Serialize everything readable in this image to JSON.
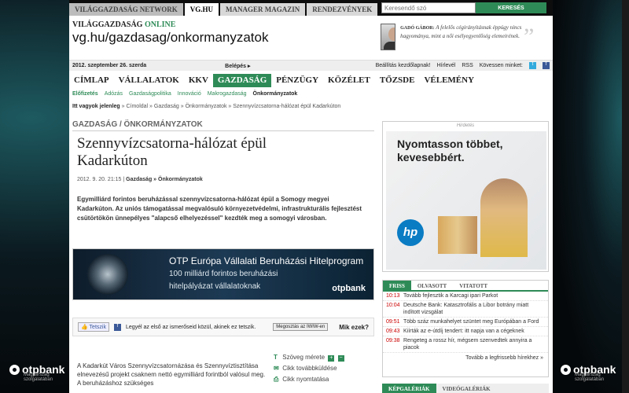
{
  "topnav": {
    "tabs": [
      {
        "label": "VILÁGGAZDASÁG Network",
        "active": false
      },
      {
        "label": "VG.hu",
        "active": true
      },
      {
        "label": "manager magazin",
        "active": false
      },
      {
        "label": "RENDEZVÉNYEK",
        "active": false
      }
    ],
    "search_placeholder": "Keresendő szó",
    "search_button": "KERESÉS"
  },
  "header": {
    "brand_prefix": "VILÁGGAZDASÁG",
    "brand_suffix": "ONLINE",
    "url": "vg.hu/gazdasag/onkormanyzatok",
    "quote_author": "GADÓ GÁBOR:",
    "quote_text": "A felelős cégirányításnak éppúgy nincs hagyománya, mint a női esélyegyenlőség elemeirének."
  },
  "datebar": {
    "date": "2012. szeptember 26. szerda",
    "login": "Belépés",
    "homepage": "Beállítás kezdőlapnak!",
    "newsletter": "Hírlevél",
    "rss": "RSS",
    "follow": "Kövessen minket:"
  },
  "mainnav": [
    "CÍMLAP",
    "VÁLLALATOK",
    "KKV",
    "GAZDASÁG",
    "PÉNZÜGY",
    "KÖZÉLET",
    "TŐZSDE",
    "VÉLEMÉNY"
  ],
  "mainnav_active": "GAZDASÁG",
  "subnav": [
    "Előfizetés",
    "Adózás",
    "Gazdaságpolitika",
    "Innováció",
    "Makrogazdaság",
    "Önkormányzatok"
  ],
  "breadcrumb": {
    "prefix": "Itt vagyok jelenleg",
    "path": "»  Címoldal  »  Gazdaság  »  Önkormányzatok  »  Szennyvízcsatorna-hálózat épül Kadarkúton"
  },
  "section_title": "GAZDASÁG / ÖNKORMÁNYZATOK",
  "article": {
    "title": "Szennyvízcsatorna-hálózat épül Kadarkúton",
    "date": "2012. 9. 20. 21:15 |",
    "category": "Gazdaság » Önkormányzatok",
    "lead": "Egymilliárd forintos beruházással szennyvízcsatorna-hálózat épül a Somogy megyei Kadarkúton. Az uniós támogatással megvalósuló környezetvédelmi, infrastrukturális fejlesztést csütörtökön ünnepélyes \"alapcső elhelyezéssel\" kezdték meg a somogyi városban.",
    "body": "A Kadarkút Város Szennyvízcsatornázása és Szennyvíztisztítása elnevezésű projekt csaknem nettó egymilliárd forintból valósul meg. A beruházáshoz szükséges"
  },
  "banner": {
    "line1": "OTP Európa Vállalati Beruházási Hitelprogram",
    "line2": "100 milliárd forintos beruházási",
    "line3": "hitelpályázat vállalatoknak",
    "logo": "otpbank"
  },
  "social": {
    "like": "Tetszik",
    "fb_text": "Legyél az első az ismerőseid közül, akinek ez tetszik.",
    "share": "Megosztás az IWIW-en",
    "mik": "Mik ezek?"
  },
  "tools": {
    "fontsize": "Szöveg mérete",
    "forward": "Cikk továbbküldése",
    "print": "Cikk nyomtatása"
  },
  "ad": {
    "label": "Hirdetés",
    "headline1": "Nyomtasson többet,",
    "headline2": "kevesebbért.",
    "hp": "hp"
  },
  "news": {
    "tabs": [
      "FRISS",
      "OLVASOTT",
      "VITATOTT"
    ],
    "items": [
      {
        "time": "10:13",
        "text": "Tovább fejlesztik a Karcagi ipari Parkot"
      },
      {
        "time": "10:04",
        "text": "Deutsche Bank: Katasztrofális a Libor botrány miatt indított vizsgálat"
      },
      {
        "time": "09:51",
        "text": "Több száz munkahelyet szüntet meg Európában a Ford"
      },
      {
        "time": "09:43",
        "text": "Kiírták az e-útdíj tendert: itt napja van a cégeknek"
      },
      {
        "time": "09:38",
        "text": "Rengeteg a rossz hír, mégsem szenvedtek annyira a piacok"
      }
    ],
    "more": "Tovább a legfrissebb hírekhez »"
  },
  "gallery": {
    "tabs": [
      "KÉPGALÉRIÁK",
      "VIDEÓGALÉRIÁK"
    ]
  },
  "side_logo": "otpbank",
  "side_logo_sub": "Magyarszág szolgálatában"
}
